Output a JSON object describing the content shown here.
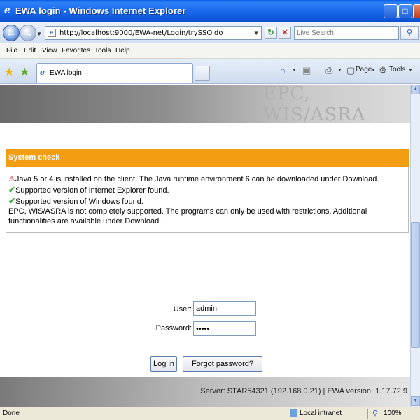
{
  "window": {
    "title": "EWA login - Windows Internet Explorer",
    "minimize": "_",
    "maximize": "□",
    "close": "✕"
  },
  "address_bar": {
    "url": "http://localhost:9000/EWA-net/Login/trySSO.do",
    "search_placeholder": "Live Search"
  },
  "menu": {
    "items": [
      "File",
      "Edit",
      "View",
      "Favorites",
      "Tools",
      "Help"
    ]
  },
  "tabs": {
    "active_tab": "EWA login"
  },
  "toolbar": {
    "page_label": "Page",
    "tools_label": "Tools"
  },
  "header": {
    "brand": "EPC, WIS/ASRA"
  },
  "system_check": {
    "title": "System check",
    "messages": [
      {
        "icon": "warning-icon",
        "text": "Java 5 or 4 is installed on the client. The Java runtime environment 6 can be downloaded under Download."
      },
      {
        "icon": "check-icon",
        "text": "Supported version of Internet Explorer found."
      },
      {
        "icon": "check-icon",
        "text": "Supported version of Windows found."
      },
      {
        "icon": "",
        "text": "EPC, WIS/ASRA is not completely supported. The programs can only be used with restrictions. Additional functionalities are available under Download."
      }
    ]
  },
  "login": {
    "user_label": "User:",
    "user_value": "admin",
    "password_label": "Password:",
    "password_value": "•••••",
    "login_button": "Log in",
    "forgot_button": "Forgot password?"
  },
  "footer": {
    "server_info": "Server: STAR54321 (192.168.0.21) | EWA version: 1.17.72.9"
  },
  "status": {
    "state": "Done",
    "zone": "Local intranet",
    "zoom": "100%"
  },
  "colors": {
    "accent_orange": "#f29d12",
    "ok_green": "#3ba83b",
    "warn_red": "#d4161a",
    "titlebar_blue": "#1f6ff0"
  }
}
